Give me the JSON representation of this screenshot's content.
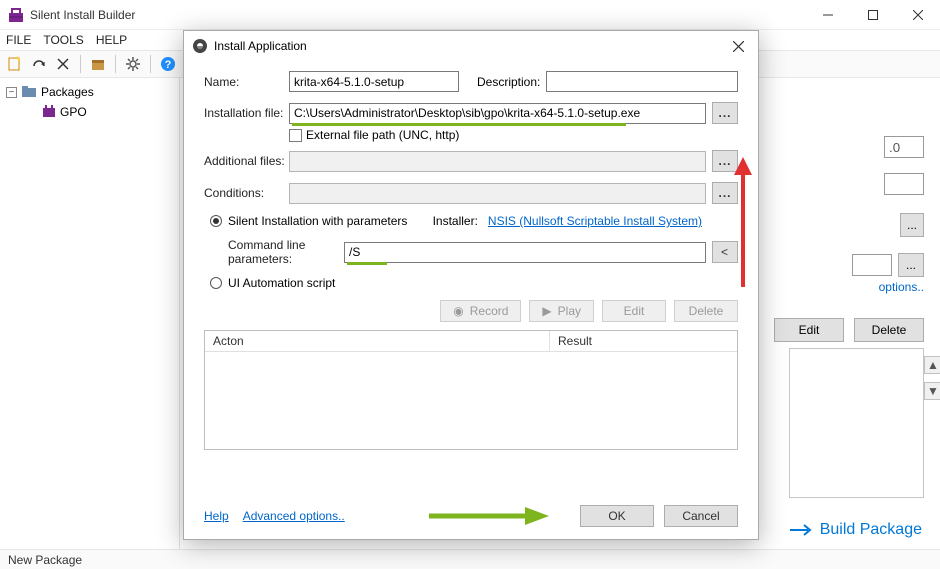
{
  "window": {
    "title": "Silent Install Builder",
    "menus": [
      "FILE",
      "TOOLS",
      "HELP"
    ]
  },
  "tree": {
    "root": "Packages",
    "child": "GPO"
  },
  "right": {
    "version_fragment": ".0",
    "options_link": "options..",
    "edit": "Edit",
    "delete": "Delete"
  },
  "build_link": "Build Package",
  "statusbar": "New Package",
  "dialog": {
    "title": "Install Application",
    "labels": {
      "name": "Name:",
      "description": "Description:",
      "installation_file": "Installation file:",
      "external_path": "External file path (UNC, http)",
      "additional_files": "Additional files:",
      "conditions": "Conditions:",
      "silent_radio": "Silent Installation with parameters",
      "installer_label": "Installer:",
      "installer_link": "NSIS (Nullsoft Scriptable Install System)",
      "cmd_params": "Command line parameters:",
      "ui_automation": "UI Automation script",
      "record": "Record",
      "play": "Play",
      "edit": "Edit",
      "delete": "Delete",
      "action_col": "Acton",
      "result_col": "Result",
      "help": "Help",
      "advanced": "Advanced options..",
      "ok": "OK",
      "cancel": "Cancel",
      "lt": "<"
    },
    "values": {
      "name": "krita-x64-5.1.0-setup",
      "description": "",
      "installation_file": "C:\\Users\\Administrator\\Desktop\\sib\\gpo\\krita-x64-5.1.0-setup.exe",
      "additional_files": "",
      "conditions": "",
      "cmd_params": "/S"
    }
  }
}
